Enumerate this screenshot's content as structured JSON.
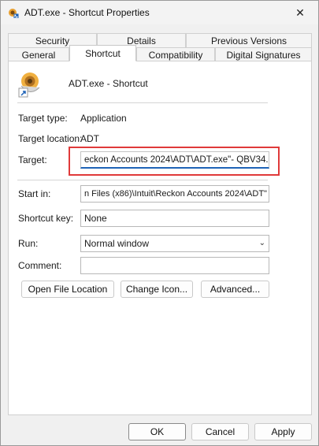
{
  "window": {
    "title": "ADT.exe - Shortcut Properties",
    "close_glyph": "✕"
  },
  "tabs_back": [
    {
      "label": "Security"
    },
    {
      "label": "Details"
    },
    {
      "label": "Previous Versions"
    }
  ],
  "tabs_front": [
    {
      "label": "General"
    },
    {
      "label": "Shortcut",
      "selected": true
    },
    {
      "label": "Compatibility"
    },
    {
      "label": "Digital Signatures"
    }
  ],
  "header": {
    "name": "ADT.exe - Shortcut",
    "icon": "application-shortcut-icon"
  },
  "info": {
    "target_type_label": "Target type:",
    "target_type_value": "Application",
    "target_location_label": "Target location:",
    "target_location_value": "ADT"
  },
  "fields": {
    "target_label": "Target:",
    "target_value": "eckon Accounts 2024\\ADT\\ADT.exe\"- QBV34.0",
    "start_in_label": "Start in:",
    "start_in_value": "n Files (x86)\\Intuit\\Reckon Accounts 2024\\ADT\"",
    "shortcut_key_label": "Shortcut key:",
    "shortcut_key_value": "None",
    "run_label": "Run:",
    "run_value": "Normal window",
    "comment_label": "Comment:",
    "comment_value": ""
  },
  "actions": {
    "open_location": "Open File Location",
    "change_icon": "Change Icon...",
    "advanced": "Advanced..."
  },
  "footer": {
    "ok": "OK",
    "cancel": "Cancel",
    "apply": "Apply"
  },
  "colors": {
    "highlight": "#e03a3a",
    "focus_underline": "#1f63b7"
  }
}
